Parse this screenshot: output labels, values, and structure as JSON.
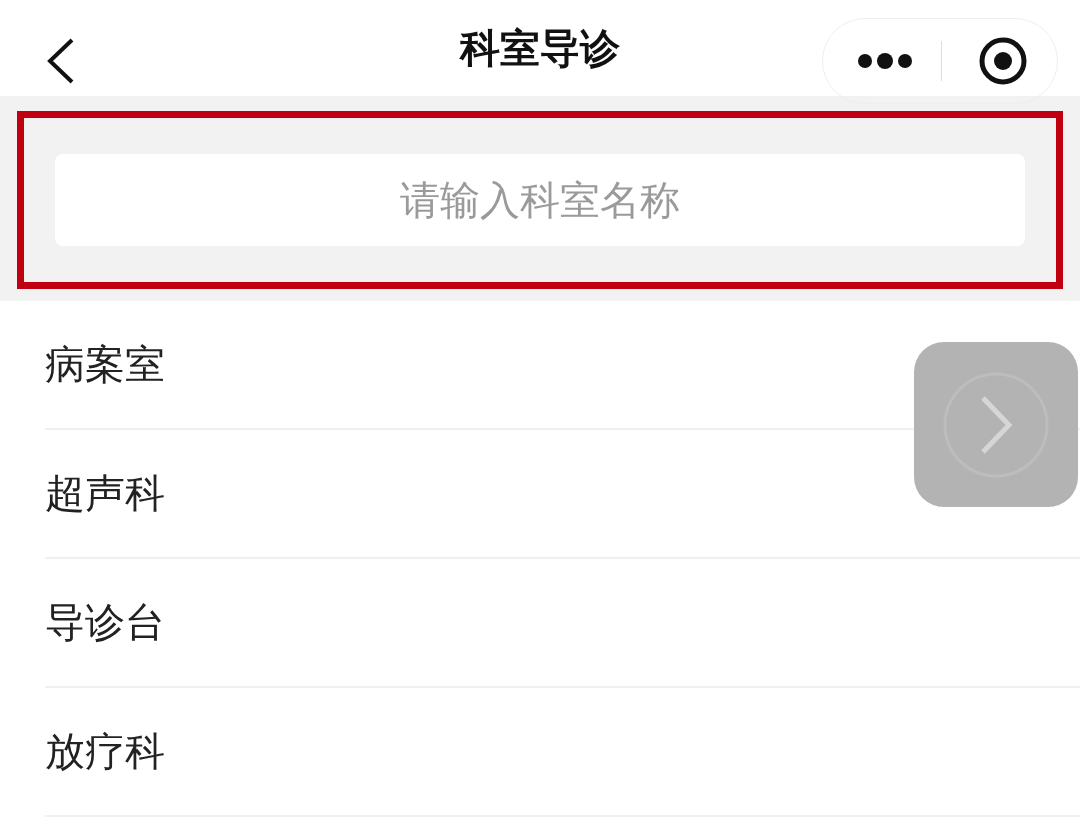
{
  "header": {
    "title": "科室导诊"
  },
  "search": {
    "placeholder": "请输入科室名称"
  },
  "departments": [
    {
      "name": "病案室"
    },
    {
      "name": "超声科"
    },
    {
      "name": "导诊台"
    },
    {
      "name": "放疗科"
    }
  ]
}
